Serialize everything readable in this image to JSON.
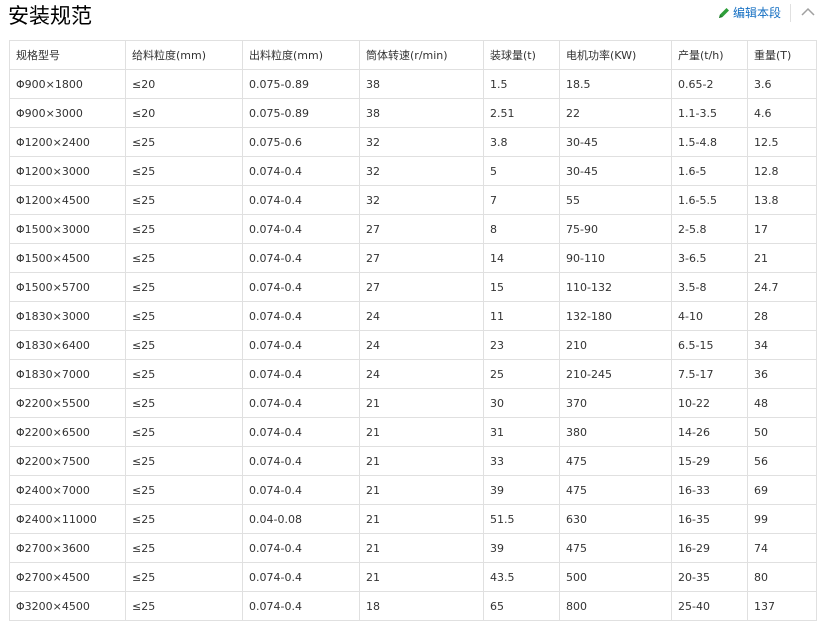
{
  "section": {
    "title": "安装规范",
    "edit_label": "编辑本段"
  },
  "table": {
    "headers": [
      "规格型号",
      "给料粒度(mm)",
      "出料粒度(mm)",
      "筒体转速(r/min)",
      "装球量(t)",
      "电机功率(KW)",
      "产量(t/h)",
      "重量(T)"
    ],
    "rows": [
      [
        "Φ900×1800",
        "≤20",
        "0.075-0.89",
        "38",
        "1.5",
        "18.5",
        "0.65-2",
        "3.6"
      ],
      [
        "Φ900×3000",
        "≤20",
        "0.075-0.89",
        "38",
        "2.51",
        "22",
        "1.1-3.5",
        "4.6"
      ],
      [
        "Φ1200×2400",
        "≤25",
        "0.075-0.6",
        "32",
        "3.8",
        "30-45",
        "1.5-4.8",
        "12.5"
      ],
      [
        "Φ1200×3000",
        "≤25",
        "0.074-0.4",
        "32",
        "5",
        "30-45",
        "1.6-5",
        "12.8"
      ],
      [
        "Φ1200×4500",
        "≤25",
        "0.074-0.4",
        "32",
        "7",
        "55",
        "1.6-5.5",
        "13.8"
      ],
      [
        "Φ1500×3000",
        "≤25",
        "0.074-0.4",
        "27",
        "8",
        "75-90",
        "2-5.8",
        "17"
      ],
      [
        "Φ1500×4500",
        "≤25",
        "0.074-0.4",
        "27",
        "14",
        "90-110",
        "3-6.5",
        "21"
      ],
      [
        "Φ1500×5700",
        "≤25",
        "0.074-0.4",
        "27",
        "15",
        "110-132",
        "3.5-8",
        "24.7"
      ],
      [
        "Φ1830×3000",
        "≤25",
        "0.074-0.4",
        "24",
        "11",
        "132-180",
        "4-10",
        "28"
      ],
      [
        "Φ1830×6400",
        "≤25",
        "0.074-0.4",
        "24",
        "23",
        "210",
        "6.5-15",
        "34"
      ],
      [
        "Φ1830×7000",
        "≤25",
        "0.074-0.4",
        "24",
        "25",
        "210-245",
        "7.5-17",
        "36"
      ],
      [
        "Φ2200×5500",
        "≤25",
        "0.074-0.4",
        "21",
        "30",
        "370",
        "10-22",
        "48"
      ],
      [
        "Φ2200×6500",
        "≤25",
        "0.074-0.4",
        "21",
        "31",
        "380",
        "14-26",
        "50"
      ],
      [
        "Φ2200×7500",
        "≤25",
        "0.074-0.4",
        "21",
        "33",
        "475",
        "15-29",
        "56"
      ],
      [
        "Φ2400×7000",
        "≤25",
        "0.074-0.4",
        "21",
        "39",
        "475",
        "16-33",
        "69"
      ],
      [
        "Φ2400×11000",
        "≤25",
        "0.04-0.08",
        "21",
        "51.5",
        "630",
        "16-35",
        "99"
      ],
      [
        "Φ2700×3600",
        "≤25",
        "0.074-0.4",
        "21",
        "39",
        "475",
        "16-29",
        "74"
      ],
      [
        "Φ2700×4500",
        "≤25",
        "0.074-0.4",
        "21",
        "43.5",
        "500",
        "20-35",
        "80"
      ],
      [
        "Φ3200×4500",
        "≤25",
        "0.074-0.4",
        "18",
        "65",
        "800",
        "25-40",
        "137"
      ]
    ]
  },
  "icons": {
    "edit": "pencil-icon",
    "collapse": "chevron-up-icon"
  },
  "colors": {
    "link": "#136ec2",
    "pencil": "#2e9e3a",
    "border": "#e0e0e0",
    "text": "#333333"
  }
}
